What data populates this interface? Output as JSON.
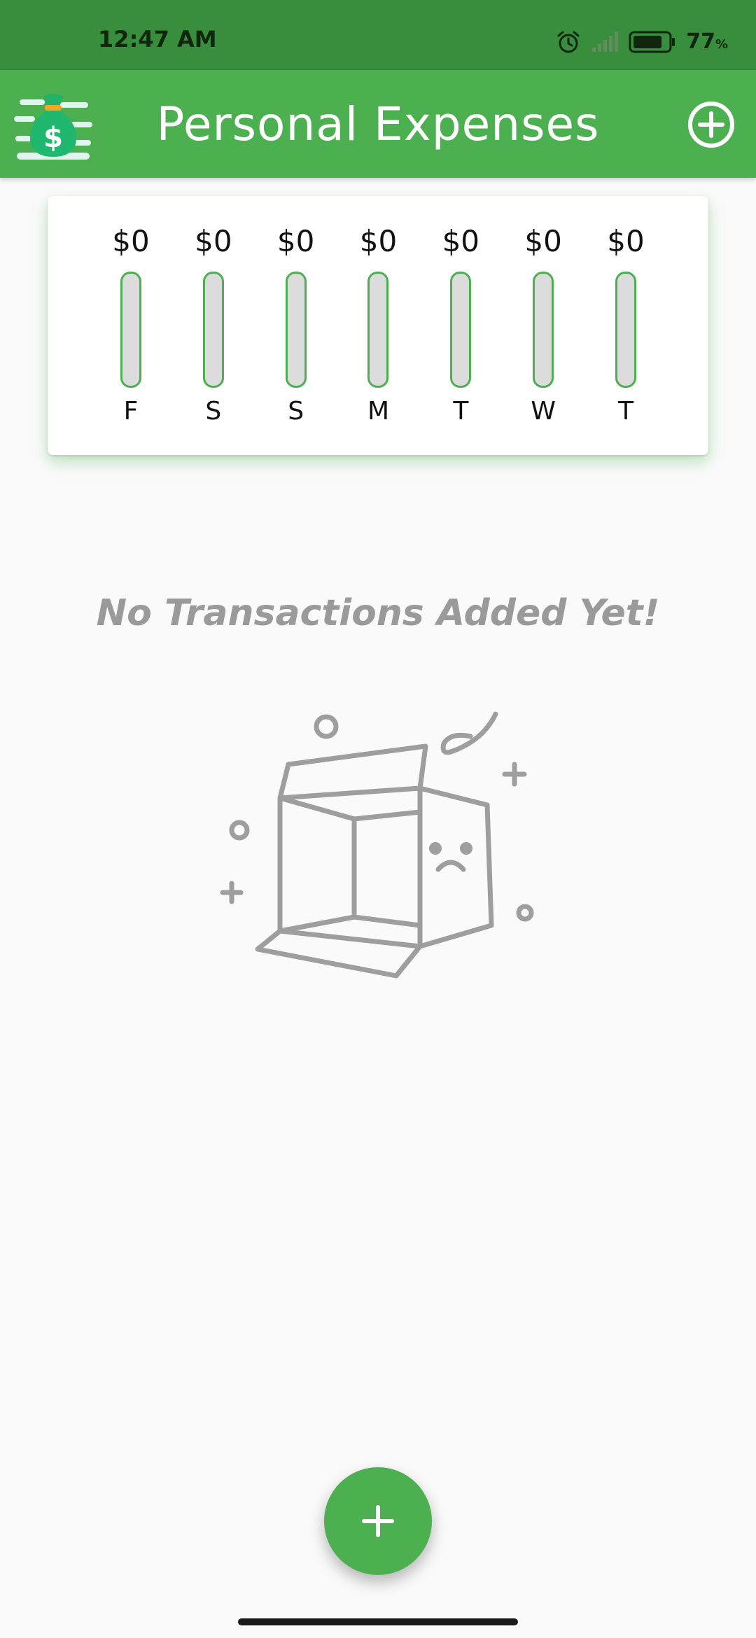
{
  "status_bar": {
    "time": "12:47 AM",
    "battery_percent": "77",
    "battery_unit": "%"
  },
  "app_bar": {
    "title": "Personal Expenses",
    "logo_icon": "money-bag-icon",
    "action_icon": "add-circle-icon"
  },
  "chart_data": {
    "type": "bar",
    "categories": [
      "F",
      "S",
      "S",
      "M",
      "T",
      "W",
      "T"
    ],
    "value_labels": [
      "$0",
      "$0",
      "$0",
      "$0",
      "$0",
      "$0",
      "$0"
    ],
    "values": [
      0,
      0,
      0,
      0,
      0,
      0,
      0
    ],
    "bar_fill_fraction": [
      0,
      0,
      0,
      0,
      0,
      0,
      0
    ]
  },
  "empty_state": {
    "message": "No Transactions Added Yet!",
    "illustration_icon": "empty-box-icon"
  },
  "fab": {
    "icon": "plus-icon"
  },
  "colors": {
    "primary": "#4caf50",
    "status_bar": "#388e3c",
    "bar_empty": "#dcdcdc",
    "muted_text": "#9a9a9a"
  }
}
